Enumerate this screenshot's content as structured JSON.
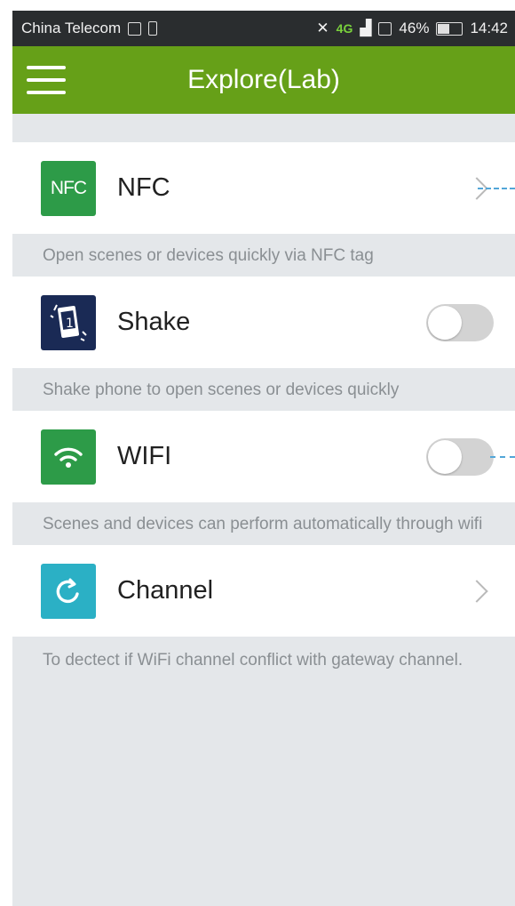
{
  "status_bar": {
    "carrier": "China Telecom",
    "network": "4G",
    "battery": "46%",
    "battery_level": 0.46,
    "time": "14:42"
  },
  "app_bar": {
    "title": "Explore(Lab)",
    "menu_icon": "hamburger-menu-icon"
  },
  "items": [
    {
      "icon_text": "NFC",
      "label": "NFC",
      "control": "chevron",
      "description": "Open scenes or devices quickly via NFC tag",
      "icon_color": "#2d9b48"
    },
    {
      "label": "Shake",
      "control": "toggle",
      "toggle_on": false,
      "description": "Shake phone to open scenes or devices quickly",
      "icon_color": "#1a2a55"
    },
    {
      "label": "WIFI",
      "control": "toggle",
      "toggle_on": false,
      "description": "Scenes and devices can perform automatically through wifi",
      "icon_color": "#2d9b48"
    },
    {
      "label": "Channel",
      "control": "chevron",
      "description": "To dectect if WiFi channel conflict with gateway channel.",
      "icon_color": "#2bb0c5"
    }
  ],
  "colors": {
    "app_bar": "#66a018",
    "background": "#e4e7ea",
    "status_bar": "#2a2d2f"
  }
}
